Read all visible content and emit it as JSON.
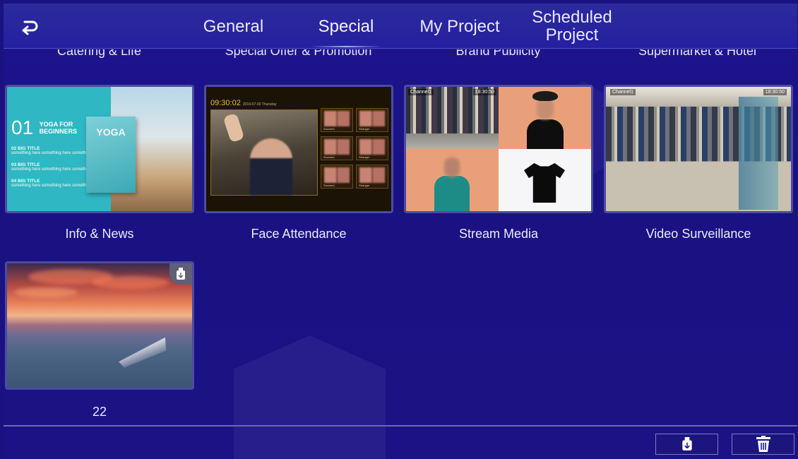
{
  "topbar": {
    "tabs": [
      {
        "label": "General"
      },
      {
        "label": "Special"
      },
      {
        "label": "My Project"
      },
      {
        "label": "Scheduled Project"
      }
    ],
    "active_tab": "Special"
  },
  "previous_row_labels": [
    "Catering & Life",
    "Special Offer & Promotion",
    "Brand Publicity",
    "Supermarket & Hotel"
  ],
  "templates": [
    {
      "label": "Info & News",
      "thumb": {
        "number": "01",
        "title_line1": "YOGA FOR",
        "title_line2": "BEGINNERS",
        "items": [
          {
            "num": "02",
            "title": "BIG TITLE",
            "text": "something here something here something here"
          },
          {
            "num": "03",
            "title": "BIG TITLE",
            "text": "something here something here something here"
          },
          {
            "num": "04",
            "title": "BIG TITLE",
            "text": "something here something here something here"
          }
        ],
        "book_title": "YOGA"
      }
    },
    {
      "label": "Face Attendance",
      "thumb": {
        "time": "09:30:02",
        "date": "2019-07-03 Thursday",
        "status_labels": [
          "Succeed",
          "Stranger"
        ]
      }
    },
    {
      "label": "Stream Media",
      "thumb": {
        "channel": "Channel1",
        "time": "18:30:50"
      }
    },
    {
      "label": "Video Surveillance",
      "thumb": {
        "channel": "Channel1",
        "time": "18:30:50"
      }
    }
  ],
  "my_items": [
    {
      "label": "22",
      "source_icon": "usb-icon"
    }
  ],
  "bottom_bar": {
    "buttons": [
      {
        "icon": "usb-icon"
      },
      {
        "icon": "trash-icon"
      }
    ]
  },
  "colors": {
    "background": "#1a1280",
    "topbar": "#2a27a0",
    "card_border": "#4d4ba3",
    "text": "#eaeaff"
  }
}
